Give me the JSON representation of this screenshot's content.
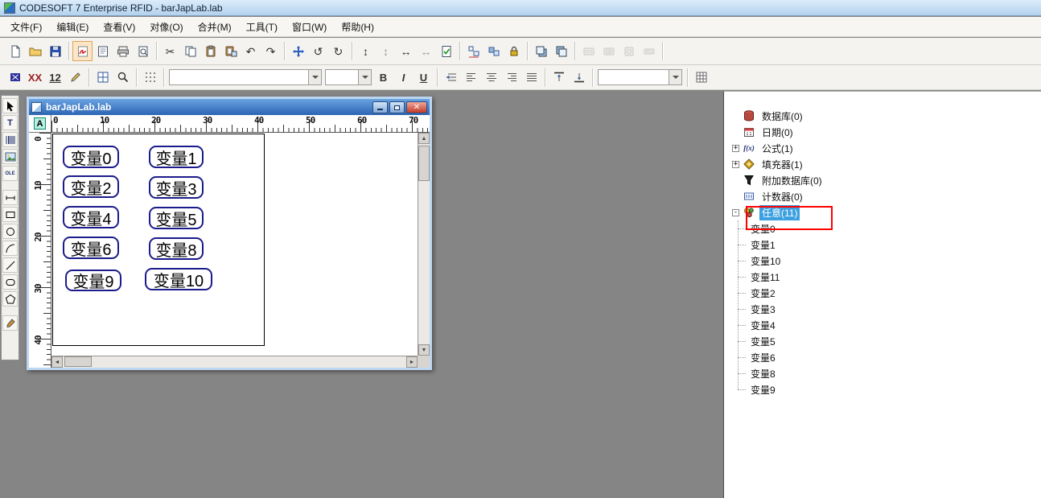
{
  "app": {
    "title": "CODESOFT 7 Enterprise RFID - barJapLab.lab"
  },
  "menubar": {
    "items": [
      "文件(F)",
      "编辑(E)",
      "查看(V)",
      "对像(O)",
      "合并(M)",
      "工具(T)",
      "窗口(W)",
      "帮助(H)"
    ]
  },
  "toolbar1": {
    "icons": [
      "new",
      "open",
      "save",
      "signature",
      "print-form",
      "printer",
      "print-preview",
      "cut",
      "copy",
      "paste",
      "paste-special",
      "undo",
      "redo",
      "move",
      "rotate-left",
      "rotate-right",
      "fit-height",
      "free-height",
      "fit-width",
      "free-width",
      "validate",
      "align-objects",
      "make-same-size",
      "lock",
      "bring-to-front",
      "send-to-back",
      "rfid-chip-1",
      "rfid-chip-2",
      "rfid-chip-3",
      "rfid-chip-4"
    ]
  },
  "toolbar2": {
    "labels": {
      "xx": "XX",
      "twelve": "12",
      "bold": "B",
      "italic": "I",
      "underline": "U"
    },
    "font_combo": {
      "value": ""
    },
    "size_combo": {
      "value": ""
    },
    "object_combo": {
      "value": ""
    }
  },
  "palette": {
    "t": "T",
    "ole": "OLE"
  },
  "doc": {
    "title": "barJapLab.lab",
    "corner": "A",
    "h_ruler": [
      "0",
      "10",
      "20",
      "30",
      "40",
      "50",
      "60",
      "70"
    ],
    "v_ruler": [
      "0",
      "10",
      "20",
      "30",
      "40"
    ],
    "variables": [
      "变量0",
      "变量1",
      "变量2",
      "变量3",
      "变量4",
      "变量5",
      "变量6",
      "变量8",
      "变量9",
      "变量10"
    ]
  },
  "tree": {
    "items": [
      {
        "label": "数据库(0)"
      },
      {
        "label": "日期(0)"
      },
      {
        "label": "公式(1)",
        "expander": "+"
      },
      {
        "label": "填充器(1)",
        "expander": "+"
      },
      {
        "label": "附加数据库(0)"
      },
      {
        "label": "计数器(0)"
      },
      {
        "label": "任意(11)",
        "expander": "-"
      }
    ],
    "children": [
      "变量0",
      "变量1",
      "变量10",
      "变量11",
      "变量2",
      "变量3",
      "变量4",
      "变量5",
      "变量6",
      "变量8",
      "变量9"
    ]
  },
  "glyphs": {
    "cut": "✂",
    "undo": "↶",
    "redo": "↷",
    "rotate_left": "↺",
    "rotate_right": "↻",
    "v_arrow": "↕",
    "h_arrow": "↔",
    "fx": "f(x)",
    "up": "▲",
    "down": "▼",
    "left": "◄",
    "right": "►",
    "close": "✕"
  },
  "colors": {
    "selection": "#3b9fe0",
    "annotation": "#ff0000",
    "variable_border": "#1b1b8a",
    "mdi_background": "#858585",
    "doc_title": "#2c65b2"
  }
}
